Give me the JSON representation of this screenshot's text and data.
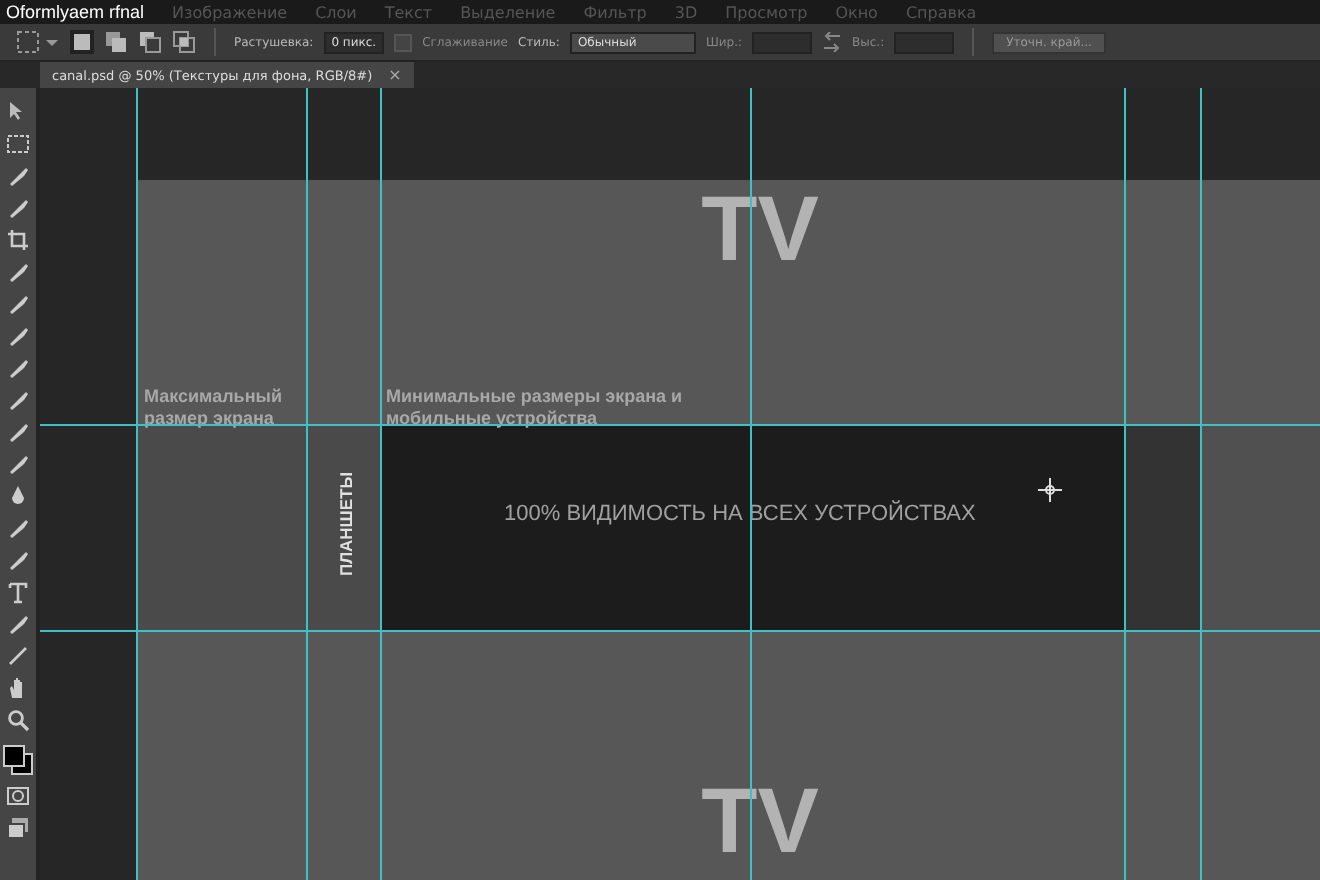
{
  "window": {
    "title": "Oformlyaem rfnal"
  },
  "menu": [
    "Изображение",
    "Слои",
    "Текст",
    "Выделение",
    "Фильтр",
    "3D",
    "Просмотр",
    "Окно",
    "Справка"
  ],
  "options_bar": {
    "feather_label": "Растушевка:",
    "feather_value": "0 пикс.",
    "antialias_label": "Сглаживание",
    "antialias_checked": false,
    "style_label": "Стиль:",
    "style_value": "Обычный",
    "width_label": "Шир.:",
    "height_label": "Выс.:",
    "refine_button": "Уточн. край..."
  },
  "document_tab": {
    "title": "canal.psd @ 50% (Текстуры для фона, RGB/8#)",
    "close": "×"
  },
  "canvas": {
    "heading_top": "TV",
    "label_max": "Максимальный размер экрана",
    "label_min": "Минимальные размеры экрана и мобильные устройства",
    "label_tablets": "ПЛАНШЕТЫ",
    "label_center": "100% ВИДИМОСТЬ НА ВСЕХ УСТРОЙСТВАХ",
    "heading_bottom": "TV"
  }
}
